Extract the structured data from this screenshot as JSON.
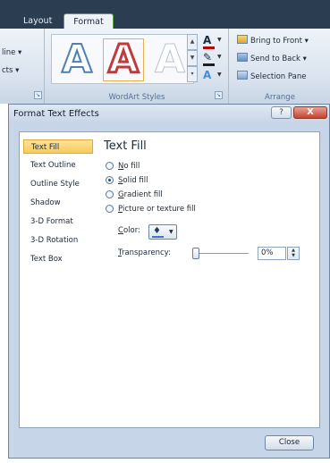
{
  "ribbon": {
    "tabs": [
      "Layout",
      "Format"
    ],
    "active_tab": "Format",
    "left_group": {
      "line1": "line ▾",
      "line2": "cts ▾"
    },
    "wordart_group": {
      "label": "WordArt Styles",
      "gallery_glyph": "A",
      "fill_button": "A",
      "effects_button": "A"
    },
    "arrange_group": {
      "label": "Arrange",
      "items": [
        "Bring to Front ▾",
        "Send to Back ▾",
        "Selection Pane"
      ]
    }
  },
  "dialog": {
    "title": "Format Text Effects",
    "help_button": "?",
    "close_x": "X",
    "nav": [
      "Text Fill",
      "Text Outline",
      "Outline Style",
      "Shadow",
      "3-D Format",
      "3-D Rotation",
      "Text Box"
    ],
    "active_nav": "Text Fill",
    "content": {
      "title": "Text Fill",
      "options": [
        {
          "key": "N",
          "rest": "o fill",
          "selected": false
        },
        {
          "key": "S",
          "rest": "olid fill",
          "selected": true
        },
        {
          "key": "G",
          "rest": "radient fill",
          "selected": false
        },
        {
          "key": "P",
          "rest": "icture or texture fill",
          "selected": false
        }
      ],
      "color_label_key": "C",
      "color_label_rest": "olor:",
      "transparency_label_key": "T",
      "transparency_label_rest": "ransparency:",
      "transparency_value": "0%"
    },
    "close_button": "Close"
  }
}
